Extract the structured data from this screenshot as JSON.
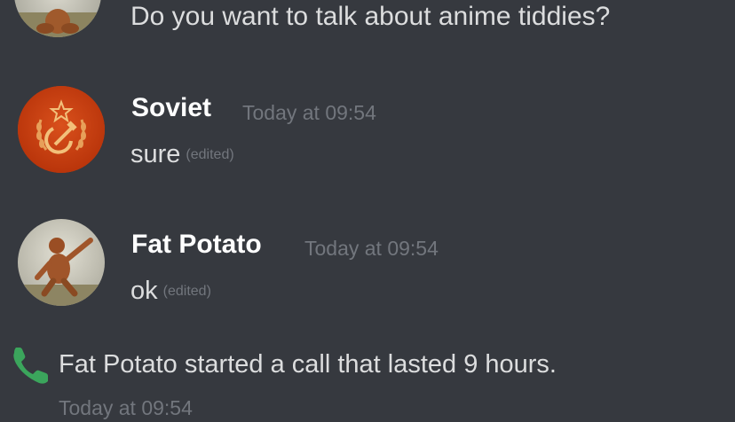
{
  "messages": {
    "first": {
      "text": "Do you want to talk about anime tiddies?"
    },
    "soviet": {
      "username": "Soviet",
      "timestamp": "Today at 09:54",
      "text": "sure",
      "edited": "(edited)"
    },
    "potato": {
      "username": "Fat Potato",
      "timestamp": "Today at 09:54",
      "text": "ok",
      "edited": "(edited)"
    }
  },
  "call": {
    "text": "Fat Potato started a call that lasted 9 hours.",
    "timestamp": "Today at 09:54",
    "icon": "phone-icon"
  },
  "colors": {
    "background": "#36393f",
    "text": "#dcddde",
    "username": "#ffffff",
    "timestamp": "#72767d",
    "call_icon": "#3ba55c",
    "soviet_avatar": "#c53b12"
  }
}
